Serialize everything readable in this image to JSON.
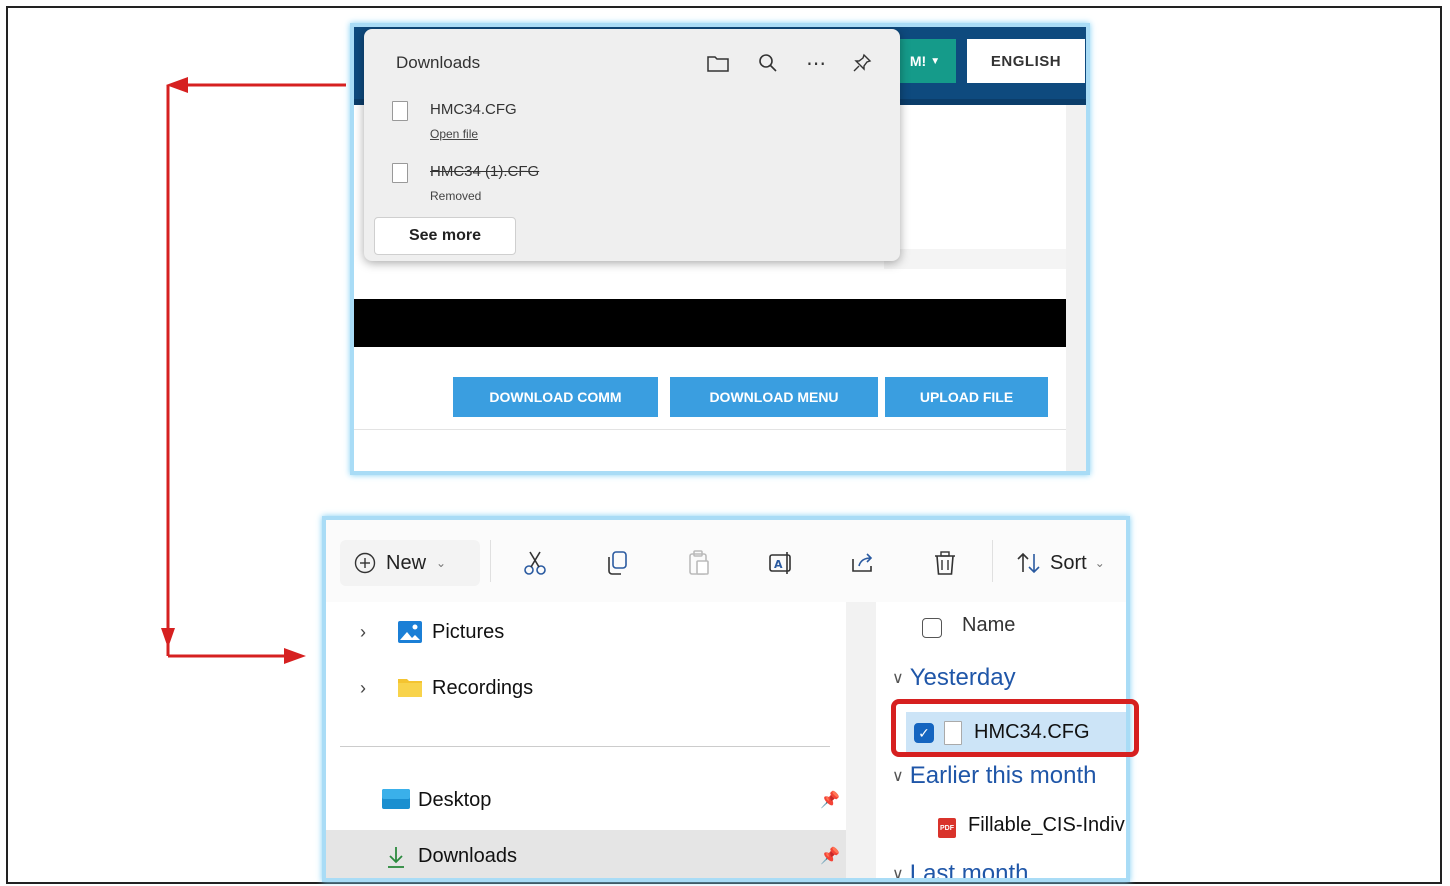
{
  "browser": {
    "nav_green_label": "M!",
    "language_label": "ENGLISH",
    "downloads_popup": {
      "title": "Downloads",
      "icons": [
        "folder-icon",
        "search-icon",
        "more-icon",
        "pin-icon"
      ],
      "items": [
        {
          "name": "HMC34.CFG",
          "sub": "Open file",
          "removed": false
        },
        {
          "name": "HMC34 (1).CFG",
          "sub": "Removed",
          "removed": true
        }
      ],
      "see_more_label": "See more"
    },
    "buttons": {
      "download_comm": "DOWNLOAD COMM",
      "download_menu": "DOWNLOAD MENU",
      "upload_file": "UPLOAD FILE"
    }
  },
  "explorer": {
    "toolbar": {
      "new_label": "New",
      "sort_label": "Sort",
      "icons": [
        "cut-icon",
        "copy-icon",
        "paste-icon",
        "rename-icon",
        "share-icon",
        "delete-icon"
      ]
    },
    "nav": {
      "items": [
        {
          "label": "Pictures",
          "icon": "pictures-icon"
        },
        {
          "label": "Recordings",
          "icon": "folder-icon"
        }
      ],
      "pinned": [
        {
          "label": "Desktop",
          "icon": "desktop-icon"
        },
        {
          "label": "Downloads",
          "icon": "download-icon"
        }
      ]
    },
    "content": {
      "column_name": "Name",
      "groups": [
        {
          "label": "Yesterday",
          "files": [
            "HMC34.CFG"
          ]
        },
        {
          "label": "Earlier this month",
          "files": [
            "Fillable_CIS-Indiv"
          ]
        },
        {
          "label": "Last month",
          "files": []
        }
      ],
      "pdf_badge": "PDF"
    }
  },
  "colors": {
    "panel_border": "#a9dcf6",
    "arrow_red": "#d62020",
    "button_blue": "#3a9ee0",
    "nav_blue": "#0e4a7e",
    "group_blue": "#1f56a8",
    "selection_blue": "#cce4f7"
  }
}
